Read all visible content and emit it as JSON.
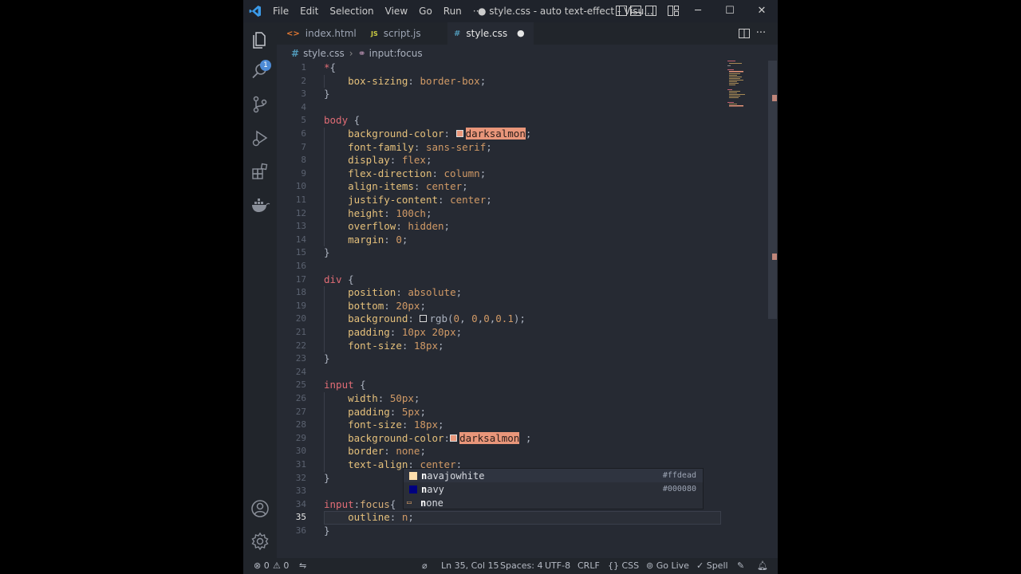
{
  "titlebar": {
    "menu": [
      "File",
      "Edit",
      "Selection",
      "View",
      "Go",
      "Run",
      "···"
    ],
    "window_title": "● style.css - auto text-effect - Visu...",
    "controls": [
      "─",
      "☐",
      "✕"
    ]
  },
  "activity": {
    "explorer_badge": "1",
    "icons": [
      "files-icon",
      "search-icon",
      "source-control-icon",
      "run-debug-icon",
      "extensions-icon",
      "docker-icon",
      "account-icon",
      "settings-gear-icon"
    ]
  },
  "tabs": [
    {
      "icon": "<>",
      "label": "index.html",
      "icon_color": "#e37933"
    },
    {
      "icon": "JS",
      "label": "script.js",
      "icon_color": "#cbcb41"
    },
    {
      "icon": "#",
      "label": "style.css",
      "icon_color": "#519aba",
      "modified": "●"
    }
  ],
  "breadcrumb": {
    "file_icon": "#",
    "file": "style.css",
    "symbol_icon": "⚭",
    "symbol": "input:focus"
  },
  "editor": {
    "current_line": 35,
    "lines": [
      {
        "n": "1",
        "parts": [
          [
            "k-sel",
            "*"
          ],
          [
            "k-br",
            "{"
          ]
        ]
      },
      {
        "n": "2",
        "parts": [
          [
            "",
            "    "
          ],
          [
            "k-prop",
            "box-sizing"
          ],
          [
            "k-punc",
            ": "
          ],
          [
            "k-val",
            "border-box"
          ],
          [
            "k-punc",
            ";"
          ]
        ]
      },
      {
        "n": "3",
        "parts": [
          [
            "k-br",
            "}"
          ]
        ]
      },
      {
        "n": "4",
        "parts": []
      },
      {
        "n": "5",
        "parts": [
          [
            "k-sel",
            "body"
          ],
          [
            "k-br",
            " {"
          ]
        ]
      },
      {
        "n": "6",
        "parts": [
          [
            "",
            "    "
          ],
          [
            "k-prop",
            "background-color"
          ],
          [
            "k-punc",
            ": "
          ],
          [
            "swatch",
            "#e9967a"
          ],
          [
            "hl-word",
            "darksalmon"
          ],
          [
            "k-punc",
            ";"
          ]
        ]
      },
      {
        "n": "7",
        "parts": [
          [
            "",
            "    "
          ],
          [
            "k-prop",
            "font-family"
          ],
          [
            "k-punc",
            ": "
          ],
          [
            "k-val",
            "sans-serif"
          ],
          [
            "k-punc",
            ";"
          ]
        ]
      },
      {
        "n": "8",
        "parts": [
          [
            "",
            "    "
          ],
          [
            "k-prop",
            "display"
          ],
          [
            "k-punc",
            ": "
          ],
          [
            "k-val",
            "flex"
          ],
          [
            "k-punc",
            ";"
          ]
        ]
      },
      {
        "n": "9",
        "parts": [
          [
            "",
            "    "
          ],
          [
            "k-prop",
            "flex-direction"
          ],
          [
            "k-punc",
            ": "
          ],
          [
            "k-val",
            "column"
          ],
          [
            "k-punc",
            ";"
          ]
        ]
      },
      {
        "n": "10",
        "parts": [
          [
            "",
            "    "
          ],
          [
            "k-prop",
            "align-items"
          ],
          [
            "k-punc",
            ": "
          ],
          [
            "k-val",
            "center"
          ],
          [
            "k-punc",
            ";"
          ]
        ]
      },
      {
        "n": "11",
        "parts": [
          [
            "",
            "    "
          ],
          [
            "k-prop",
            "justify-content"
          ],
          [
            "k-punc",
            ": "
          ],
          [
            "k-val",
            "center"
          ],
          [
            "k-punc",
            ";"
          ]
        ]
      },
      {
        "n": "12",
        "parts": [
          [
            "",
            "    "
          ],
          [
            "k-prop",
            "height"
          ],
          [
            "k-punc",
            ": "
          ],
          [
            "k-val",
            "100ch"
          ],
          [
            "k-punc",
            ";"
          ]
        ]
      },
      {
        "n": "13",
        "parts": [
          [
            "",
            "    "
          ],
          [
            "k-prop",
            "overflow"
          ],
          [
            "k-punc",
            ": "
          ],
          [
            "k-val",
            "hidden"
          ],
          [
            "k-punc",
            ";"
          ]
        ]
      },
      {
        "n": "14",
        "parts": [
          [
            "",
            "    "
          ],
          [
            "k-prop",
            "margin"
          ],
          [
            "k-punc",
            ": "
          ],
          [
            "k-val",
            "0"
          ],
          [
            "k-punc",
            ";"
          ]
        ]
      },
      {
        "n": "15",
        "parts": [
          [
            "k-br",
            "}"
          ]
        ]
      },
      {
        "n": "16",
        "parts": []
      },
      {
        "n": "17",
        "parts": [
          [
            "k-sel",
            "div"
          ],
          [
            "k-br",
            " {"
          ]
        ]
      },
      {
        "n": "18",
        "parts": [
          [
            "",
            "    "
          ],
          [
            "k-prop",
            "position"
          ],
          [
            "k-punc",
            ": "
          ],
          [
            "k-val",
            "absolute"
          ],
          [
            "k-punc",
            ";"
          ]
        ]
      },
      {
        "n": "19",
        "parts": [
          [
            "",
            "    "
          ],
          [
            "k-prop",
            "bottom"
          ],
          [
            "k-punc",
            ": "
          ],
          [
            "k-val",
            "20px"
          ],
          [
            "k-punc",
            ";"
          ]
        ]
      },
      {
        "n": "20",
        "parts": [
          [
            "",
            "    "
          ],
          [
            "k-prop",
            "background"
          ],
          [
            "k-punc",
            ": "
          ],
          [
            "swatch",
            "rgba(0,0,0,0.1)"
          ],
          [
            "k-br",
            "rgb"
          ],
          [
            "k-punc",
            "("
          ],
          [
            "k-val",
            "0"
          ],
          [
            "k-punc",
            ", "
          ],
          [
            "k-val",
            "0"
          ],
          [
            "k-punc",
            ","
          ],
          [
            "k-val",
            "0"
          ],
          [
            "k-punc",
            ","
          ],
          [
            "k-val",
            "0.1"
          ],
          [
            "k-punc",
            ");"
          ]
        ]
      },
      {
        "n": "21",
        "parts": [
          [
            "",
            "    "
          ],
          [
            "k-prop",
            "padding"
          ],
          [
            "k-punc",
            ": "
          ],
          [
            "k-val",
            "10px 20px"
          ],
          [
            "k-punc",
            ";"
          ]
        ]
      },
      {
        "n": "22",
        "parts": [
          [
            "",
            "    "
          ],
          [
            "k-prop",
            "font-size"
          ],
          [
            "k-punc",
            ": "
          ],
          [
            "k-val",
            "18px"
          ],
          [
            "k-punc",
            ";"
          ]
        ]
      },
      {
        "n": "23",
        "parts": [
          [
            "k-br",
            "}"
          ]
        ]
      },
      {
        "n": "24",
        "parts": []
      },
      {
        "n": "25",
        "parts": [
          [
            "k-sel",
            "input"
          ],
          [
            "k-br",
            " {"
          ]
        ]
      },
      {
        "n": "26",
        "parts": [
          [
            "",
            "    "
          ],
          [
            "k-prop",
            "width"
          ],
          [
            "k-punc",
            ": "
          ],
          [
            "k-val",
            "50px"
          ],
          [
            "k-punc",
            ";"
          ]
        ]
      },
      {
        "n": "27",
        "parts": [
          [
            "",
            "    "
          ],
          [
            "k-prop",
            "padding"
          ],
          [
            "k-punc",
            ": "
          ],
          [
            "k-val",
            "5px"
          ],
          [
            "k-punc",
            ";"
          ]
        ]
      },
      {
        "n": "28",
        "parts": [
          [
            "",
            "    "
          ],
          [
            "k-prop",
            "font-size"
          ],
          [
            "k-punc",
            ": "
          ],
          [
            "k-val",
            "18px"
          ],
          [
            "k-punc",
            ";"
          ]
        ]
      },
      {
        "n": "29",
        "parts": [
          [
            "",
            "    "
          ],
          [
            "k-prop",
            "background-color"
          ],
          [
            "k-punc",
            ":"
          ],
          [
            "swatch",
            "#e9967a"
          ],
          [
            "hl-word",
            "darksalmon"
          ],
          [
            "k-punc",
            " ;"
          ]
        ]
      },
      {
        "n": "30",
        "parts": [
          [
            "",
            "    "
          ],
          [
            "k-prop",
            "border"
          ],
          [
            "k-punc",
            ": "
          ],
          [
            "k-val",
            "none"
          ],
          [
            "k-punc",
            ";"
          ]
        ]
      },
      {
        "n": "31",
        "parts": [
          [
            "",
            "    "
          ],
          [
            "k-prop",
            "text-align"
          ],
          [
            "k-punc",
            ": "
          ],
          [
            "k-val",
            "center"
          ],
          [
            "k-punc",
            ";"
          ]
        ]
      },
      {
        "n": "32",
        "parts": [
          [
            "k-br",
            "}"
          ]
        ]
      },
      {
        "n": "33",
        "parts": []
      },
      {
        "n": "34",
        "parts": [
          [
            "k-sel",
            "input"
          ],
          [
            "k-punc",
            ":"
          ],
          [
            "k-prop2",
            "focus"
          ],
          [
            "k-br",
            "{"
          ]
        ]
      },
      {
        "n": "35",
        "parts": [
          [
            "",
            "    "
          ],
          [
            "k-prop",
            "outline"
          ],
          [
            "k-punc",
            ": "
          ],
          [
            "k-val",
            "n"
          ],
          [
            "k-punc",
            ";"
          ]
        ]
      },
      {
        "n": "36",
        "parts": [
          [
            "k-br",
            "}"
          ]
        ]
      }
    ]
  },
  "suggest": [
    {
      "match": "n",
      "rest": "avajowhite",
      "detail": "#ffdead",
      "swatch": "#ffdead"
    },
    {
      "match": "n",
      "rest": "avy",
      "detail": "#000080",
      "swatch": "#000080"
    },
    {
      "match": "n",
      "rest": "one",
      "detail": "",
      "swatch": ""
    }
  ],
  "status": {
    "errors": "⊗ 0",
    "warnings": "⚠ 0",
    "position": "Ln 35, Col 15",
    "spaces": "Spaces: 4",
    "encoding": "UTF-8",
    "eol": "CRLF",
    "language": "{} CSS",
    "golive": "Go Live",
    "spell": "✓ Spell"
  }
}
